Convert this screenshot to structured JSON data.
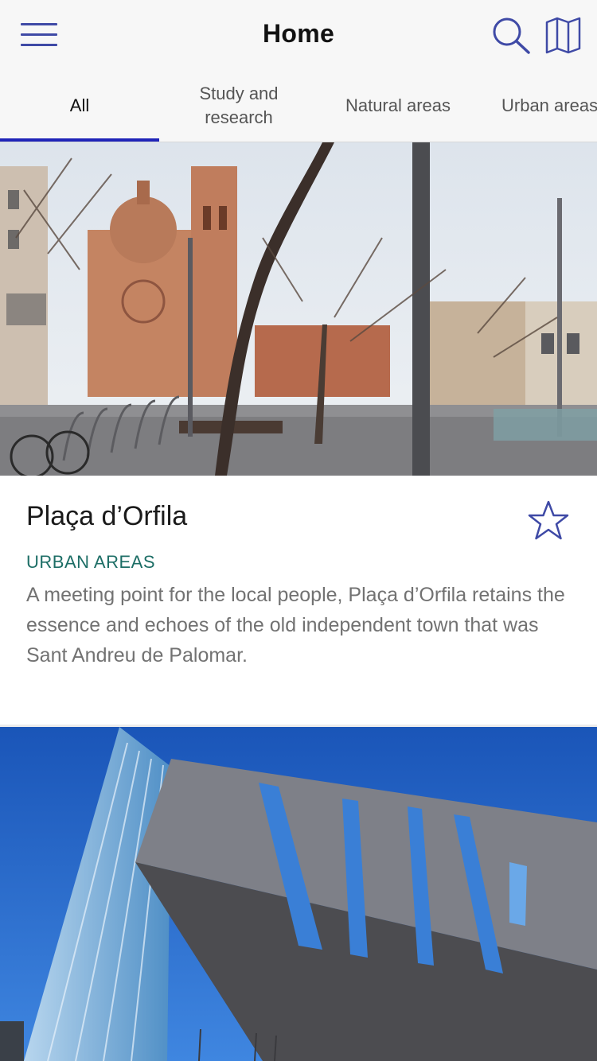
{
  "header": {
    "title": "Home",
    "icons": {
      "menu": "hamburger-menu-icon",
      "search": "search-icon",
      "map": "map-icon"
    },
    "accent_color": "#3f4aa6"
  },
  "tabs": [
    {
      "label": "All",
      "active": true
    },
    {
      "label": "Study and research",
      "active": false
    },
    {
      "label": "Natural areas",
      "active": false
    },
    {
      "label": "Urban areas",
      "active": false
    }
  ],
  "tab_indicator_color": "#1f24b8",
  "cards": [
    {
      "title": "Plaça d’Orfila",
      "category": "URBAN AREAS",
      "description": "A meeting point for the local people, Plaça d’Orfila retains the essence and echoes of the old independent town that was Sant Andreu de Palomar.",
      "favorite": false,
      "favorite_icon": "star-outline-icon",
      "image": "photo of town square with church and trees"
    },
    {
      "image": "photo of modern building against blue sky"
    }
  ],
  "category_color": "#1d6e66"
}
